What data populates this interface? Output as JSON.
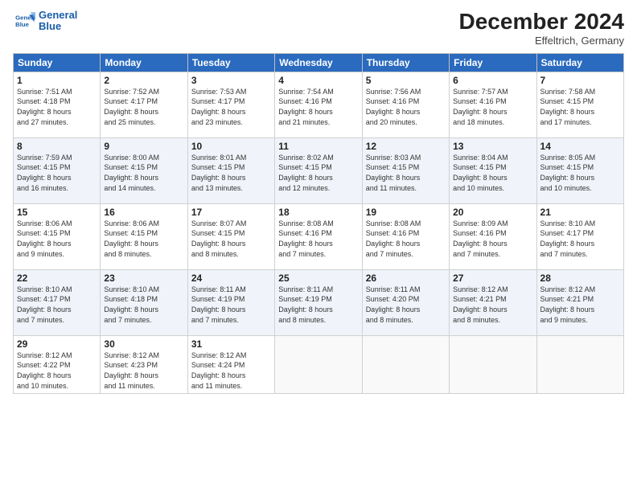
{
  "header": {
    "logo_line1": "General",
    "logo_line2": "Blue",
    "month": "December 2024",
    "location": "Effeltrich, Germany"
  },
  "weekdays": [
    "Sunday",
    "Monday",
    "Tuesday",
    "Wednesday",
    "Thursday",
    "Friday",
    "Saturday"
  ],
  "weeks": [
    [
      {
        "day": "1",
        "lines": [
          "Sunrise: 7:51 AM",
          "Sunset: 4:18 PM",
          "Daylight: 8 hours",
          "and 27 minutes."
        ]
      },
      {
        "day": "2",
        "lines": [
          "Sunrise: 7:52 AM",
          "Sunset: 4:17 PM",
          "Daylight: 8 hours",
          "and 25 minutes."
        ]
      },
      {
        "day": "3",
        "lines": [
          "Sunrise: 7:53 AM",
          "Sunset: 4:17 PM",
          "Daylight: 8 hours",
          "and 23 minutes."
        ]
      },
      {
        "day": "4",
        "lines": [
          "Sunrise: 7:54 AM",
          "Sunset: 4:16 PM",
          "Daylight: 8 hours",
          "and 21 minutes."
        ]
      },
      {
        "day": "5",
        "lines": [
          "Sunrise: 7:56 AM",
          "Sunset: 4:16 PM",
          "Daylight: 8 hours",
          "and 20 minutes."
        ]
      },
      {
        "day": "6",
        "lines": [
          "Sunrise: 7:57 AM",
          "Sunset: 4:16 PM",
          "Daylight: 8 hours",
          "and 18 minutes."
        ]
      },
      {
        "day": "7",
        "lines": [
          "Sunrise: 7:58 AM",
          "Sunset: 4:15 PM",
          "Daylight: 8 hours",
          "and 17 minutes."
        ]
      }
    ],
    [
      {
        "day": "8",
        "lines": [
          "Sunrise: 7:59 AM",
          "Sunset: 4:15 PM",
          "Daylight: 8 hours",
          "and 16 minutes."
        ]
      },
      {
        "day": "9",
        "lines": [
          "Sunrise: 8:00 AM",
          "Sunset: 4:15 PM",
          "Daylight: 8 hours",
          "and 14 minutes."
        ]
      },
      {
        "day": "10",
        "lines": [
          "Sunrise: 8:01 AM",
          "Sunset: 4:15 PM",
          "Daylight: 8 hours",
          "and 13 minutes."
        ]
      },
      {
        "day": "11",
        "lines": [
          "Sunrise: 8:02 AM",
          "Sunset: 4:15 PM",
          "Daylight: 8 hours",
          "and 12 minutes."
        ]
      },
      {
        "day": "12",
        "lines": [
          "Sunrise: 8:03 AM",
          "Sunset: 4:15 PM",
          "Daylight: 8 hours",
          "and 11 minutes."
        ]
      },
      {
        "day": "13",
        "lines": [
          "Sunrise: 8:04 AM",
          "Sunset: 4:15 PM",
          "Daylight: 8 hours",
          "and 10 minutes."
        ]
      },
      {
        "day": "14",
        "lines": [
          "Sunrise: 8:05 AM",
          "Sunset: 4:15 PM",
          "Daylight: 8 hours",
          "and 10 minutes."
        ]
      }
    ],
    [
      {
        "day": "15",
        "lines": [
          "Sunrise: 8:06 AM",
          "Sunset: 4:15 PM",
          "Daylight: 8 hours",
          "and 9 minutes."
        ]
      },
      {
        "day": "16",
        "lines": [
          "Sunrise: 8:06 AM",
          "Sunset: 4:15 PM",
          "Daylight: 8 hours",
          "and 8 minutes."
        ]
      },
      {
        "day": "17",
        "lines": [
          "Sunrise: 8:07 AM",
          "Sunset: 4:15 PM",
          "Daylight: 8 hours",
          "and 8 minutes."
        ]
      },
      {
        "day": "18",
        "lines": [
          "Sunrise: 8:08 AM",
          "Sunset: 4:16 PM",
          "Daylight: 8 hours",
          "and 7 minutes."
        ]
      },
      {
        "day": "19",
        "lines": [
          "Sunrise: 8:08 AM",
          "Sunset: 4:16 PM",
          "Daylight: 8 hours",
          "and 7 minutes."
        ]
      },
      {
        "day": "20",
        "lines": [
          "Sunrise: 8:09 AM",
          "Sunset: 4:16 PM",
          "Daylight: 8 hours",
          "and 7 minutes."
        ]
      },
      {
        "day": "21",
        "lines": [
          "Sunrise: 8:10 AM",
          "Sunset: 4:17 PM",
          "Daylight: 8 hours",
          "and 7 minutes."
        ]
      }
    ],
    [
      {
        "day": "22",
        "lines": [
          "Sunrise: 8:10 AM",
          "Sunset: 4:17 PM",
          "Daylight: 8 hours",
          "and 7 minutes."
        ]
      },
      {
        "day": "23",
        "lines": [
          "Sunrise: 8:10 AM",
          "Sunset: 4:18 PM",
          "Daylight: 8 hours",
          "and 7 minutes."
        ]
      },
      {
        "day": "24",
        "lines": [
          "Sunrise: 8:11 AM",
          "Sunset: 4:19 PM",
          "Daylight: 8 hours",
          "and 7 minutes."
        ]
      },
      {
        "day": "25",
        "lines": [
          "Sunrise: 8:11 AM",
          "Sunset: 4:19 PM",
          "Daylight: 8 hours",
          "and 8 minutes."
        ]
      },
      {
        "day": "26",
        "lines": [
          "Sunrise: 8:11 AM",
          "Sunset: 4:20 PM",
          "Daylight: 8 hours",
          "and 8 minutes."
        ]
      },
      {
        "day": "27",
        "lines": [
          "Sunrise: 8:12 AM",
          "Sunset: 4:21 PM",
          "Daylight: 8 hours",
          "and 8 minutes."
        ]
      },
      {
        "day": "28",
        "lines": [
          "Sunrise: 8:12 AM",
          "Sunset: 4:21 PM",
          "Daylight: 8 hours",
          "and 9 minutes."
        ]
      }
    ],
    [
      {
        "day": "29",
        "lines": [
          "Sunrise: 8:12 AM",
          "Sunset: 4:22 PM",
          "Daylight: 8 hours",
          "and 10 minutes."
        ]
      },
      {
        "day": "30",
        "lines": [
          "Sunrise: 8:12 AM",
          "Sunset: 4:23 PM",
          "Daylight: 8 hours",
          "and 11 minutes."
        ]
      },
      {
        "day": "31",
        "lines": [
          "Sunrise: 8:12 AM",
          "Sunset: 4:24 PM",
          "Daylight: 8 hours",
          "and 11 minutes."
        ]
      },
      {
        "day": "",
        "lines": []
      },
      {
        "day": "",
        "lines": []
      },
      {
        "day": "",
        "lines": []
      },
      {
        "day": "",
        "lines": []
      }
    ]
  ]
}
